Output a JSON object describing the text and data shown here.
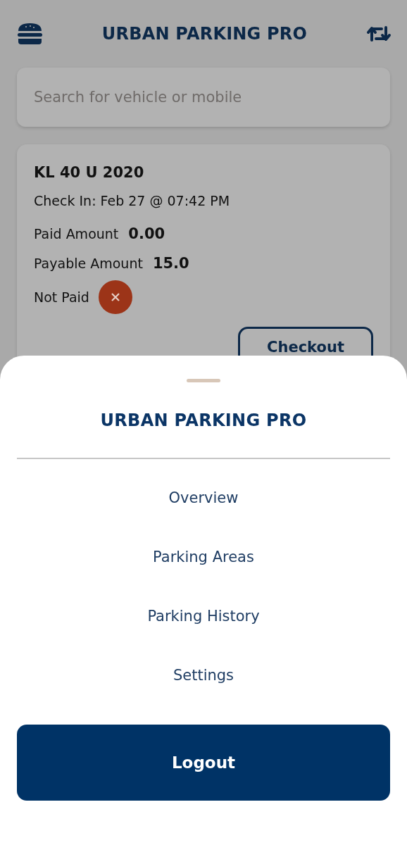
{
  "app_bar": {
    "title": "URBAN PARKING PRO"
  },
  "search": {
    "placeholder": "Search for vehicle or mobile"
  },
  "vehicle_card": {
    "plate": "KL 40 U 2020",
    "check_in": "Check In: Feb 27 @ 07:42 PM",
    "paid_label": "Paid Amount",
    "paid_value": "0.00",
    "payable_label": "Payable Amount",
    "payable_value": "15.0",
    "status": "Not Paid",
    "paid": false,
    "button": "Checkout"
  },
  "menu_sheet": {
    "title": "URBAN PARKING PRO",
    "items": [
      {
        "label": "Overview"
      },
      {
        "label": "Parking Areas"
      },
      {
        "label": "Parking History"
      },
      {
        "label": "Settings"
      }
    ],
    "logout": "Logout"
  }
}
